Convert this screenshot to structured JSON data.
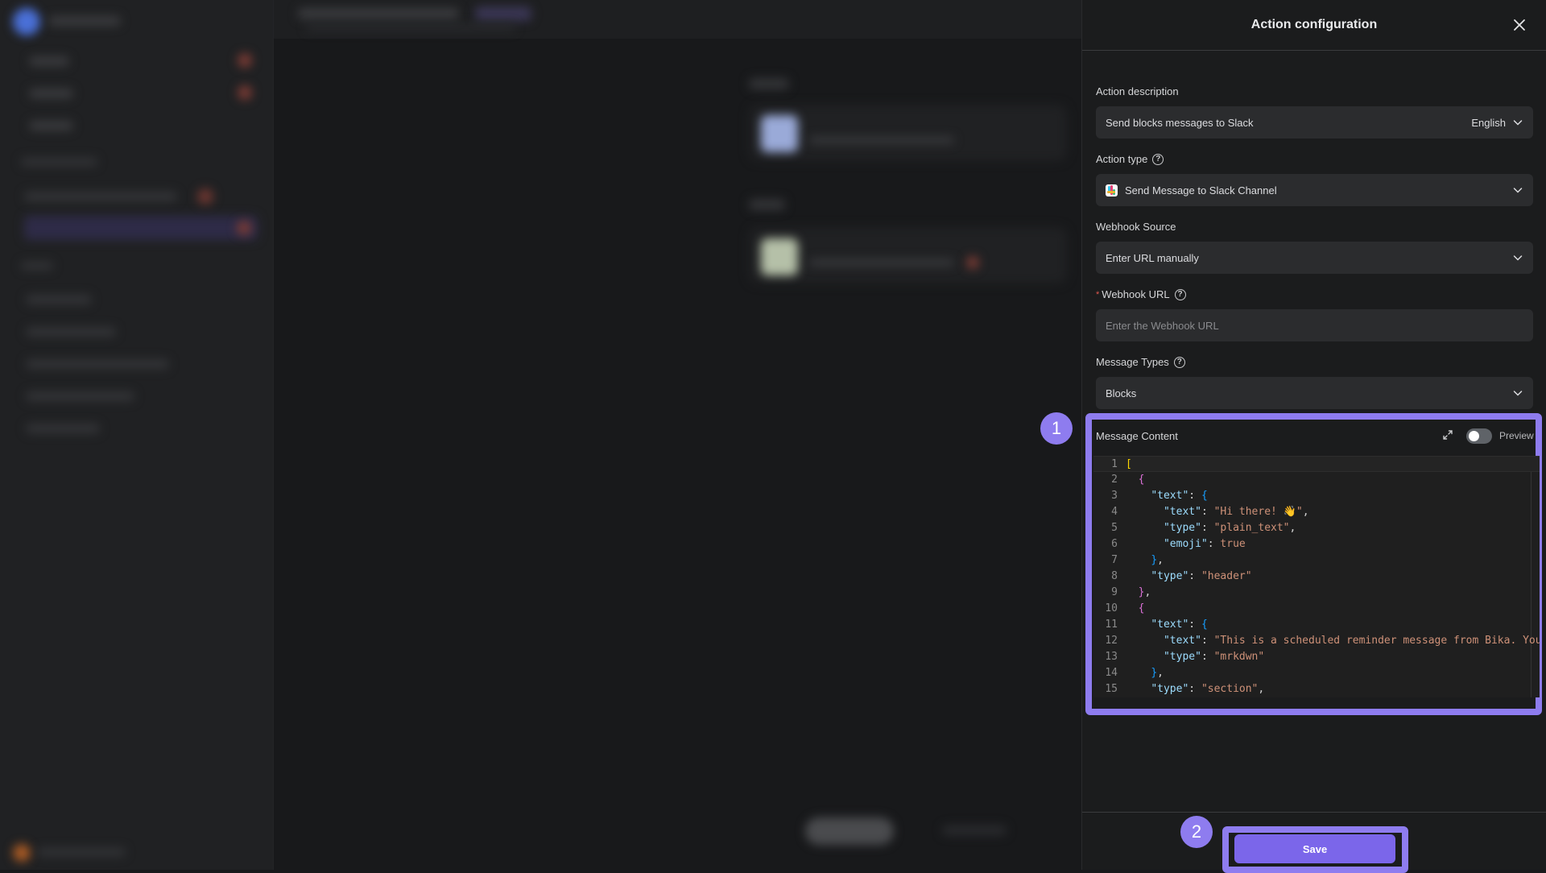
{
  "panel": {
    "title": "Action configuration",
    "close_icon": "close-icon"
  },
  "fields": {
    "action_description": {
      "label": "Action description",
      "value": "Send blocks messages to Slack",
      "language": "English"
    },
    "action_type": {
      "label": "Action type",
      "value": "Send Message to Slack Channel",
      "icon": "slack-icon"
    },
    "webhook_source": {
      "label": "Webhook Source",
      "value": "Enter URL manually"
    },
    "webhook_url": {
      "required_mark": "*",
      "label": "Webhook URL",
      "value": "",
      "placeholder": "Enter the Webhook URL"
    },
    "message_types": {
      "label": "Message Types",
      "value": "Blocks"
    },
    "message_content": {
      "label": "Message Content",
      "preview_label": "Preview",
      "preview_enabled": false,
      "lines": [
        {
          "n": "1",
          "tokens": [
            [
              "tk-b1",
              "["
            ]
          ]
        },
        {
          "n": "2",
          "tokens": [
            [
              "tk-p",
              "  "
            ],
            [
              "tk-b2",
              "{"
            ]
          ]
        },
        {
          "n": "3",
          "tokens": [
            [
              "tk-p",
              "    "
            ],
            [
              "tk-key",
              "\"text\""
            ],
            [
              "tk-p",
              ": "
            ],
            [
              "tk-b3",
              "{"
            ]
          ]
        },
        {
          "n": "4",
          "tokens": [
            [
              "tk-p",
              "      "
            ],
            [
              "tk-key",
              "\"text\""
            ],
            [
              "tk-p",
              ": "
            ],
            [
              "tk-str",
              "\"Hi there! 👋\""
            ],
            [
              "tk-p",
              ","
            ]
          ]
        },
        {
          "n": "5",
          "tokens": [
            [
              "tk-p",
              "      "
            ],
            [
              "tk-key",
              "\"type\""
            ],
            [
              "tk-p",
              ": "
            ],
            [
              "tk-str",
              "\"plain_text\""
            ],
            [
              "tk-p",
              ","
            ]
          ]
        },
        {
          "n": "6",
          "tokens": [
            [
              "tk-p",
              "      "
            ],
            [
              "tk-key",
              "\"emoji\""
            ],
            [
              "tk-p",
              ": "
            ],
            [
              "tk-bool",
              "true"
            ]
          ]
        },
        {
          "n": "7",
          "tokens": [
            [
              "tk-p",
              "    "
            ],
            [
              "tk-b3",
              "}"
            ],
            [
              "tk-p",
              ","
            ]
          ]
        },
        {
          "n": "8",
          "tokens": [
            [
              "tk-p",
              "    "
            ],
            [
              "tk-key",
              "\"type\""
            ],
            [
              "tk-p",
              ": "
            ],
            [
              "tk-str",
              "\"header\""
            ]
          ]
        },
        {
          "n": "9",
          "tokens": [
            [
              "tk-p",
              "  "
            ],
            [
              "tk-b2",
              "}"
            ],
            [
              "tk-p",
              ","
            ]
          ]
        },
        {
          "n": "10",
          "tokens": [
            [
              "tk-p",
              "  "
            ],
            [
              "tk-b2",
              "{"
            ]
          ]
        },
        {
          "n": "11",
          "tokens": [
            [
              "tk-p",
              "    "
            ],
            [
              "tk-key",
              "\"text\""
            ],
            [
              "tk-p",
              ": "
            ],
            [
              "tk-b3",
              "{"
            ]
          ]
        },
        {
          "n": "12",
          "tokens": [
            [
              "tk-p",
              "      "
            ],
            [
              "tk-key",
              "\"text\""
            ],
            [
              "tk-p",
              ": "
            ],
            [
              "tk-str",
              "\"This is a scheduled reminder message from Bika. You"
            ]
          ]
        },
        {
          "n": "13",
          "tokens": [
            [
              "tk-p",
              "      "
            ],
            [
              "tk-key",
              "\"type\""
            ],
            [
              "tk-p",
              ": "
            ],
            [
              "tk-str",
              "\"mrkdwn\""
            ]
          ]
        },
        {
          "n": "14",
          "tokens": [
            [
              "tk-p",
              "    "
            ],
            [
              "tk-b3",
              "}"
            ],
            [
              "tk-p",
              ","
            ]
          ]
        },
        {
          "n": "15",
          "tokens": [
            [
              "tk-p",
              "    "
            ],
            [
              "tk-key",
              "\"type\""
            ],
            [
              "tk-p",
              ": "
            ],
            [
              "tk-str",
              "\"section\""
            ],
            [
              "tk-p",
              ","
            ]
          ]
        }
      ]
    }
  },
  "footer": {
    "save_label": "Save"
  },
  "annotations": {
    "step1": "1",
    "step2": "2",
    "highlight_color": "#8e7cef"
  },
  "colors": {
    "accent": "#7b66ea",
    "panel_bg": "#1b1c1d",
    "input_bg": "#2b2c2e"
  }
}
